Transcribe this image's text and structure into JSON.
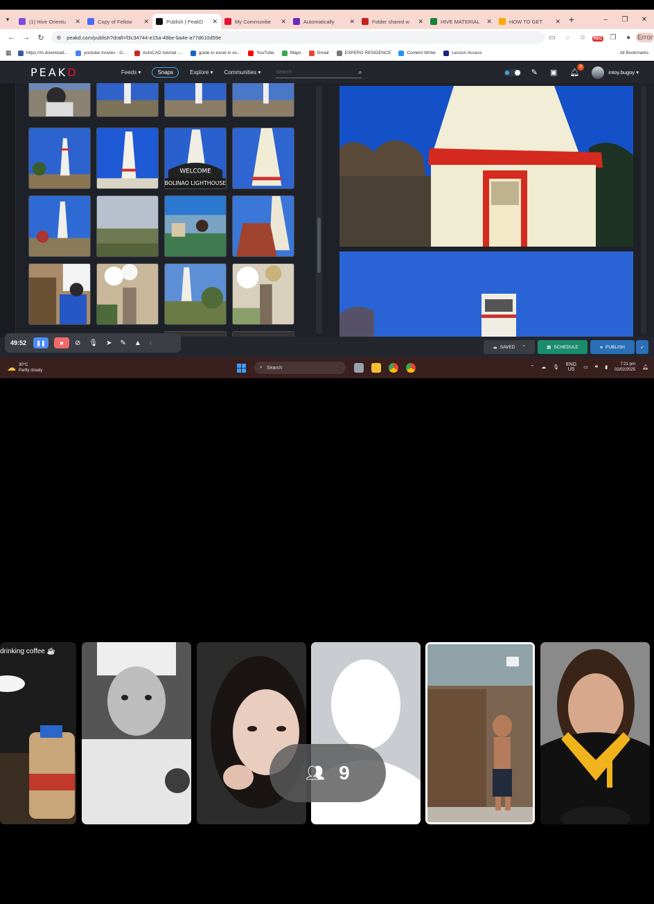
{
  "browser": {
    "tabs": [
      {
        "title": "(1) Hive Orientu",
        "color": "#7d4cdb"
      },
      {
        "title": "Copy of Fellow",
        "color": "#4a6cf7"
      },
      {
        "title": "Publish | PeakD",
        "color": "#111111",
        "active": true
      },
      {
        "title": "My Communitie",
        "color": "#e31337"
      },
      {
        "title": "Automatically",
        "color": "#6b2bbd"
      },
      {
        "title": "Folder shared w",
        "color": "#c5221f"
      },
      {
        "title": "HIVE MATERIAL",
        "color": "#188038"
      },
      {
        "title": "HOW TO GET",
        "color": "#f9ab00"
      }
    ],
    "url": "peakd.com/publish?draft=f3c34744-e15a-48be-ba4e-a77d610d59e",
    "profile_label": "Error",
    "bookmarks": [
      {
        "label": "https://m.download...",
        "color": "#3b5998"
      },
      {
        "label": "youtube movies - G...",
        "color": "#4285f4"
      },
      {
        "label": "AutoCAD tutorial -...",
        "color": "#c62828"
      },
      {
        "label": "guide to excel in ev...",
        "color": "#1565c0"
      },
      {
        "label": "YouTube",
        "color": "#ff0000"
      },
      {
        "label": "Maps",
        "color": "#34a853"
      },
      {
        "label": "Gmail",
        "color": "#ea4335"
      },
      {
        "label": "ESPERO RESIDENCE",
        "color": "#777777"
      },
      {
        "label": "Content Writer",
        "color": "#2196f3"
      },
      {
        "label": "Lesson Access",
        "color": "#1a237e"
      }
    ],
    "all_bookmarks": "All Bookmarks"
  },
  "peakd": {
    "logo_main": "PEAK",
    "logo_accent": "D",
    "nav": {
      "feeds": "Feeds",
      "snaps": "Snaps",
      "explore": "Explore",
      "communities": "Communities"
    },
    "search_placeholder": "Search",
    "notification_count": "9",
    "username": "intoy.bugoy"
  },
  "recorder": {
    "time": "49:52"
  },
  "actions": {
    "saved": "SAVED",
    "schedule": "SCHEDULE",
    "publish": "PUBLISH"
  },
  "taskbar": {
    "temp": "30°C",
    "weather": "Partly cloudy",
    "search": "Search",
    "lang": "ENG",
    "region": "US",
    "time": "7:21 pm",
    "date": "02/02/2025"
  },
  "call": {
    "caption": "drinking coffee ☕",
    "participant_count": "9"
  }
}
